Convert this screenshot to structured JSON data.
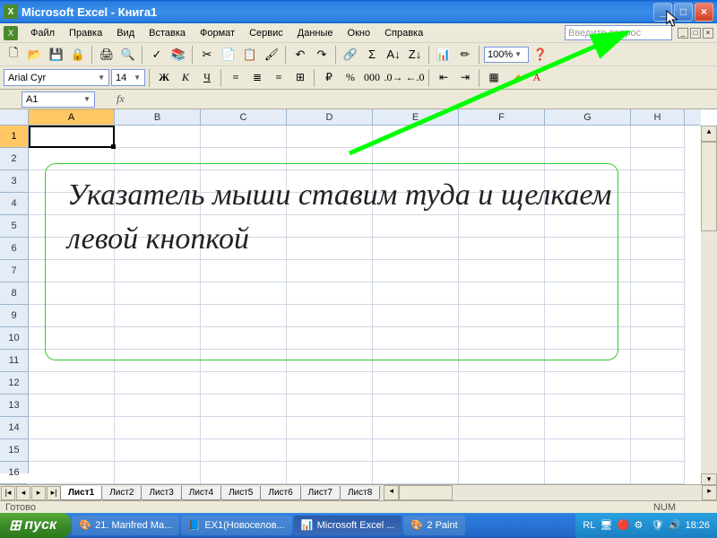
{
  "title": "Microsoft Excel - Книга1",
  "menus": [
    "Файл",
    "Правка",
    "Вид",
    "Вставка",
    "Формат",
    "Сервис",
    "Данные",
    "Окно",
    "Справка"
  ],
  "ask_placeholder": "Введите вопрос",
  "zoom": "100%",
  "font": {
    "name": "Arial Cyr",
    "size": "14"
  },
  "name_box": "A1",
  "fx": "fx",
  "columns": [
    "A",
    "B",
    "C",
    "D",
    "E",
    "F",
    "G",
    "H"
  ],
  "rows": [
    "1",
    "2",
    "3",
    "4",
    "5",
    "6",
    "7",
    "8",
    "9",
    "10",
    "11",
    "12",
    "13",
    "14",
    "15",
    "16"
  ],
  "sheets": [
    "Лист1",
    "Лист2",
    "Лист3",
    "Лист4",
    "Лист5",
    "Лист6",
    "Лист7",
    "Лист8"
  ],
  "status": {
    "left": "Готово",
    "right": "NUM"
  },
  "taskbar": {
    "start": "пуск",
    "items": [
      {
        "icon": "🎨",
        "label": "21. Manfred Ma..."
      },
      {
        "icon": "📘",
        "label": "EX1(Новоселов..."
      },
      {
        "icon": "📊",
        "label": "Microsoft Excel ..."
      },
      {
        "icon": "🎨",
        "label": "2 Paint"
      }
    ],
    "lang": "RL",
    "clock": "18:26"
  },
  "annotation": "Указатель мыши ставим туда и щелкаем левой кнопкой"
}
